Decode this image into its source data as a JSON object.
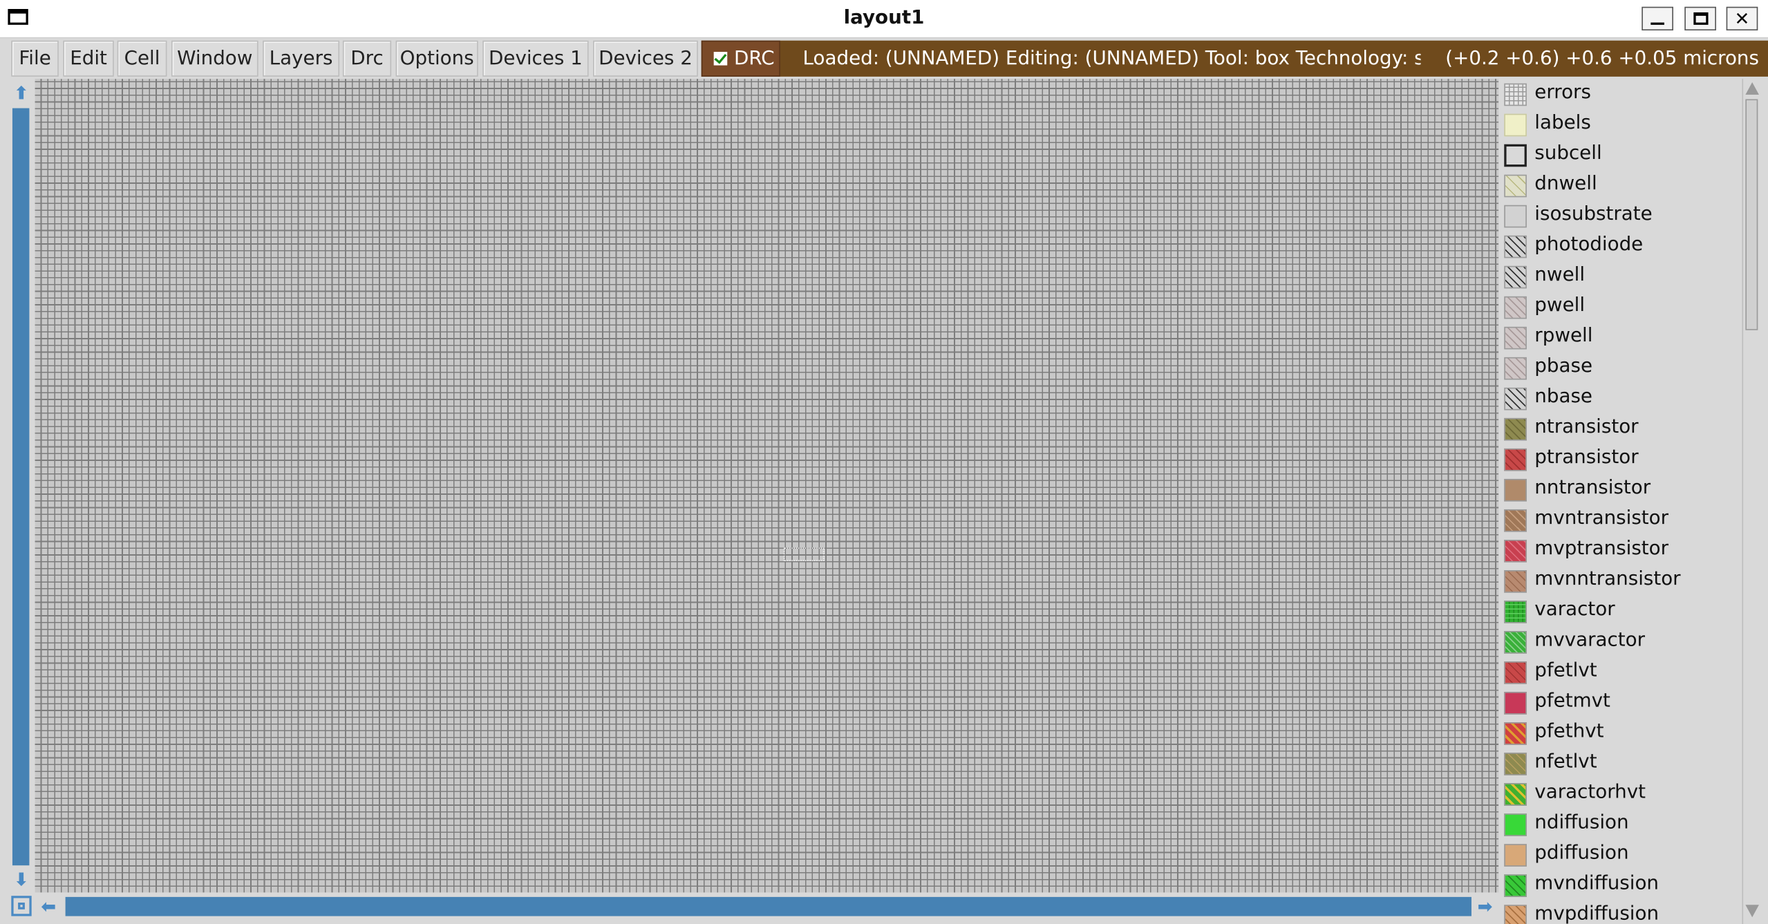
{
  "window": {
    "title": "layout1",
    "minimize_icon": "minimize-icon",
    "maximize_icon": "maximize-icon",
    "close_label": "✕"
  },
  "menus": [
    "File",
    "Edit",
    "Cell",
    "Window",
    "Layers",
    "Drc",
    "Options",
    "Devices 1",
    "Devices 2"
  ],
  "drc": {
    "label": "DRC",
    "checked": true
  },
  "status": {
    "message": "Loaded: (UNNAMED) Editing: (UNNAMED) Tool: box  Technology: sky",
    "coords": "(+0.2 +0.6) +0.6 +0.05 microns"
  },
  "layers": [
    "errors",
    "labels",
    "subcell",
    "dnwell",
    "isosubstrate",
    "photodiode",
    "nwell",
    "pwell",
    "rpwell",
    "pbase",
    "nbase",
    "ntransistor",
    "ptransistor",
    "nntransistor",
    "mvntransistor",
    "mvptransistor",
    "mvnntransistor",
    "varactor",
    "mvvaractor",
    "pfetlvt",
    "pfetmvt",
    "pfethvt",
    "nfetlvt",
    "varactorhvt",
    "ndiffusion",
    "pdiffusion",
    "mvndiffusion",
    "mvpdiffusion"
  ],
  "colors": {
    "status_bg": "#6f4a1c",
    "drc_bg": "#7a4a28",
    "scrollbar": "#4682b4",
    "canvas_bg": "#c8c8c8"
  }
}
